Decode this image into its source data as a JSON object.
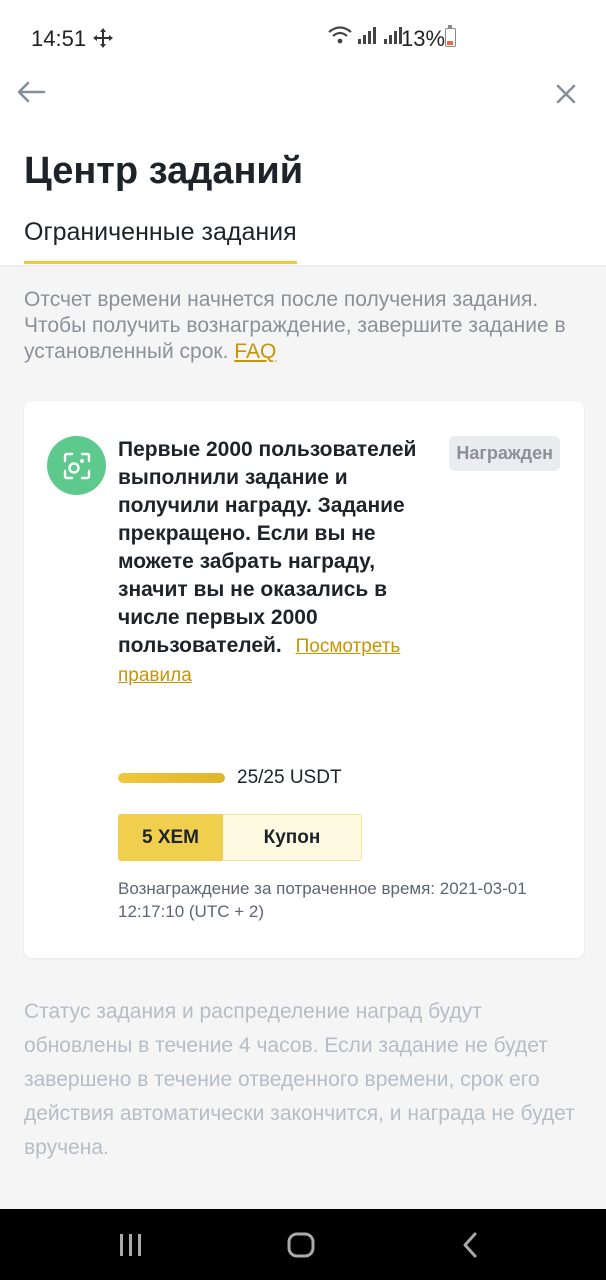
{
  "status_bar": {
    "time": "14:51",
    "battery_pct": "13%"
  },
  "header": {
    "title": "Центр заданий",
    "tab_label": "Ограниченные задания"
  },
  "intro": {
    "text": "Отсчет времени начнется после получения задания. Чтобы получить вознаграждение, завершите задание в установленный срок.",
    "faq_label": "FAQ"
  },
  "task": {
    "description": "Первые 2000 пользователей выполнили задание и получили награду. Задание прекращено. Если вы не можете забрать награду, значит вы не оказались в числе первых 2000 пользователей.",
    "rules_link": "Посмотреть правила",
    "status_badge": "Награжден",
    "progress": {
      "fraction": 1.0,
      "label": "25/25 USDT"
    },
    "reward_amount": "5 XEM",
    "reward_type": "Купон",
    "reward_time": "Вознаграждение за потраченное время: 2021-03-01 12:17:10 (UTC + 2)"
  },
  "footer_note": "Статус задания и распределение наград будут обновлены в течение 4 часов. Если задание не будет завершено в течение отведенного времени, срок его действия автоматически закончится, и награда не будет вручена.",
  "colors": {
    "accent": "#f0c93a",
    "link": "#c99400",
    "icon_bg": "#5dc98c"
  }
}
